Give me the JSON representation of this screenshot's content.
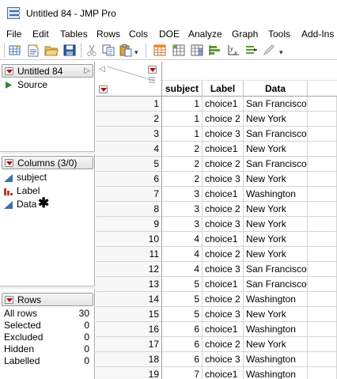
{
  "window": {
    "title": "Untitled 84 - JMP Pro"
  },
  "menu": [
    "File",
    "Edit",
    "Tables",
    "Rows",
    "Cols",
    "DOE",
    "Analyze",
    "Graph",
    "Tools",
    "Add-Ins"
  ],
  "table_panel": {
    "title": "Untitled 84",
    "source_label": "Source"
  },
  "columns_panel": {
    "title": "Columns (3/0)",
    "columns": [
      {
        "name": "subject",
        "icon": "continuous-icon"
      },
      {
        "name": "Label",
        "icon": "nominal-icon"
      },
      {
        "name": "Data",
        "icon": "continuous-icon",
        "marker": "✱"
      }
    ]
  },
  "rows_panel": {
    "title": "Rows",
    "stats": [
      {
        "label": "All rows",
        "value": "30"
      },
      {
        "label": "Selected",
        "value": "0"
      },
      {
        "label": "Excluded",
        "value": "0"
      },
      {
        "label": "Hidden",
        "value": "0"
      },
      {
        "label": "Labelled",
        "value": "0"
      }
    ]
  },
  "grid": {
    "headers": [
      "subject",
      "Label",
      "Data"
    ],
    "rows": [
      {
        "n": "1",
        "subject": "1",
        "label": "choice1",
        "data": "San Francisco"
      },
      {
        "n": "2",
        "subject": "1",
        "label": "choice 2",
        "data": "New York"
      },
      {
        "n": "3",
        "subject": "1",
        "label": "choice 3",
        "data": "San Francisco"
      },
      {
        "n": "4",
        "subject": "2",
        "label": "choice1",
        "data": "New York"
      },
      {
        "n": "5",
        "subject": "2",
        "label": "choice 2",
        "data": "San Francisco"
      },
      {
        "n": "6",
        "subject": "2",
        "label": "choice 3",
        "data": "New York"
      },
      {
        "n": "7",
        "subject": "3",
        "label": "choice1",
        "data": "Washington"
      },
      {
        "n": "8",
        "subject": "3",
        "label": "choice 2",
        "data": "New York"
      },
      {
        "n": "9",
        "subject": "3",
        "label": "choice 3",
        "data": "New York"
      },
      {
        "n": "10",
        "subject": "4",
        "label": "choice1",
        "data": "New York"
      },
      {
        "n": "11",
        "subject": "4",
        "label": "choice 2",
        "data": "New York"
      },
      {
        "n": "12",
        "subject": "4",
        "label": "choice 3",
        "data": "San Francisco"
      },
      {
        "n": "13",
        "subject": "5",
        "label": "choice1",
        "data": "San Francisco"
      },
      {
        "n": "14",
        "subject": "5",
        "label": "choice 2",
        "data": "Washington"
      },
      {
        "n": "15",
        "subject": "5",
        "label": "choice 3",
        "data": "New York"
      },
      {
        "n": "16",
        "subject": "6",
        "label": "choice1",
        "data": "Washington"
      },
      {
        "n": "17",
        "subject": "6",
        "label": "choice 2",
        "data": "New York"
      },
      {
        "n": "18",
        "subject": "6",
        "label": "choice 3",
        "data": "Washington"
      },
      {
        "n": "19",
        "subject": "7",
        "label": "choice1",
        "data": "Washington"
      }
    ]
  },
  "colors": {
    "accent_red": "#c00000",
    "icon_blue": "#3a6fb0"
  }
}
